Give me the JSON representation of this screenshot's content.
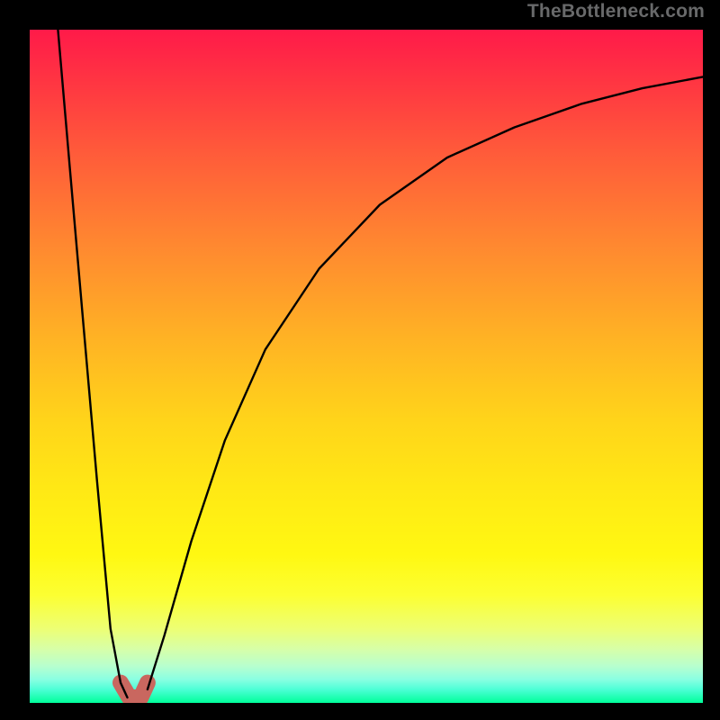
{
  "watermark": "TheBottleneck.com",
  "chart_data": {
    "type": "line",
    "title": "",
    "xlabel": "",
    "ylabel": "",
    "xlim": [
      0,
      1
    ],
    "ylim": [
      0,
      1
    ],
    "grid": false,
    "legend": false,
    "series": [
      {
        "name": "left_branch",
        "x": [
          0.042,
          0.06,
          0.08,
          0.1,
          0.12,
          0.135,
          0.145
        ],
        "y": [
          1.0,
          0.79,
          0.56,
          0.33,
          0.11,
          0.03,
          0.008
        ]
      },
      {
        "name": "right_branch",
        "x": [
          0.175,
          0.2,
          0.24,
          0.29,
          0.35,
          0.43,
          0.52,
          0.62,
          0.72,
          0.82,
          0.91,
          1.0
        ],
        "y": [
          0.02,
          0.1,
          0.24,
          0.39,
          0.525,
          0.645,
          0.74,
          0.81,
          0.855,
          0.89,
          0.913,
          0.93
        ]
      },
      {
        "name": "trough_highlight",
        "x": [
          0.135,
          0.148,
          0.165,
          0.175
        ],
        "y": [
          0.03,
          0.008,
          0.008,
          0.03
        ]
      }
    ],
    "colors": {
      "curve": "#000000",
      "trough": "#c9675f",
      "gradient_top": "#ff1a49",
      "gradient_bottom": "#00ff9a"
    }
  }
}
